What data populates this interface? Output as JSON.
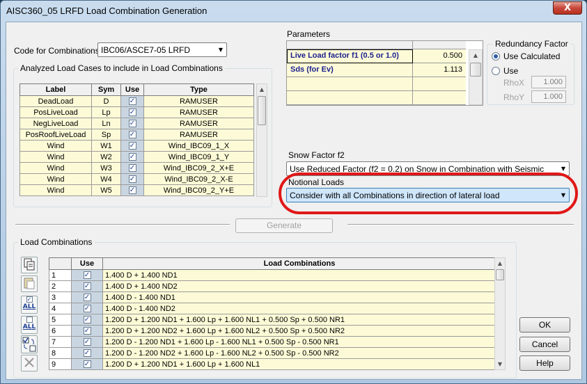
{
  "window": {
    "title": "AISC360_05 LRFD  Load Combination Generation",
    "close_symbol": "X"
  },
  "code": {
    "label": "Code for Combinations:",
    "value": "IBC06/ASCE7-05 LRFD"
  },
  "analyzed": {
    "title": "Analyzed Load Cases to include in Load Combinations",
    "columns": [
      "Label",
      "Sym",
      "Use",
      "Type"
    ],
    "rows": [
      {
        "label": "DeadLoad",
        "sym": "D",
        "use": true,
        "type": "RAMUSER"
      },
      {
        "label": "PosLiveLoad",
        "sym": "Lp",
        "use": true,
        "type": "RAMUSER"
      },
      {
        "label": "NegLiveLoad",
        "sym": "Ln",
        "use": true,
        "type": "RAMUSER"
      },
      {
        "label": "PosRoofLiveLoad",
        "sym": "Sp",
        "use": true,
        "type": "RAMUSER"
      },
      {
        "label": "Wind",
        "sym": "W1",
        "use": true,
        "type": "Wind_IBC09_1_X"
      },
      {
        "label": "Wind",
        "sym": "W2",
        "use": true,
        "type": "Wind_IBC09_1_Y"
      },
      {
        "label": "Wind",
        "sym": "W3",
        "use": true,
        "type": "Wind_IBC09_2_X+E"
      },
      {
        "label": "Wind",
        "sym": "W4",
        "use": true,
        "type": "Wind_IBC09_2_X-E"
      },
      {
        "label": "Wind",
        "sym": "W5",
        "use": true,
        "type": "Wind_IBC09_2_Y+E"
      }
    ]
  },
  "parameters": {
    "title": "Parameters",
    "rows": [
      {
        "name": "Live Load factor f1 (0.5 or 1.0)",
        "value": "0.500"
      },
      {
        "name": "Sds (for Ev)",
        "value": "1.113"
      }
    ]
  },
  "redundancy": {
    "title": "Redundancy Factor",
    "opt_calculated": "Use Calculated",
    "opt_use": "Use",
    "rhox_label": "RhoX",
    "rhox_value": "1.000",
    "rhoy_label": "RhoY",
    "rhoy_value": "1.000",
    "selected": "Use Calculated"
  },
  "snow": {
    "label": "Snow Factor f2",
    "value": "Use Reduced Factor (f2 = 0.2) on Snow in Combination with Seismic"
  },
  "notional": {
    "label": "Notional Loads",
    "value": "Consider with all Combinations in direction of lateral load"
  },
  "generate_label": "Generate",
  "combinations": {
    "title": "Load Combinations",
    "columns": [
      "Use",
      "Load Combinations"
    ],
    "rows": [
      {
        "num": "1",
        "use": true,
        "combo": "1.400 D + 1.400 ND1"
      },
      {
        "num": "2",
        "use": true,
        "combo": "1.400 D + 1.400 ND2"
      },
      {
        "num": "3",
        "use": true,
        "combo": "1.400 D - 1.400 ND1"
      },
      {
        "num": "4",
        "use": true,
        "combo": "1.400 D - 1.400 ND2"
      },
      {
        "num": "5",
        "use": true,
        "combo": "1.200 D + 1.200 ND1 + 1.600 Lp + 1.600 NL1 + 0.500 Sp + 0.500 NR1"
      },
      {
        "num": "6",
        "use": true,
        "combo": "1.200 D + 1.200 ND2 + 1.600 Lp + 1.600 NL2 + 0.500 Sp + 0.500 NR2"
      },
      {
        "num": "7",
        "use": true,
        "combo": "1.200 D - 1.200 ND1 + 1.600 Lp - 1.600 NL1 + 0.500 Sp - 0.500 NR1"
      },
      {
        "num": "8",
        "use": true,
        "combo": "1.200 D - 1.200 ND2 + 1.600 Lp - 1.600 NL2 + 0.500 Sp - 0.500 NR2"
      },
      {
        "num": "9",
        "use": true,
        "combo": "1.200 D + 1.200 ND1 + 1.600 Lp + 1.600 NL1"
      }
    ]
  },
  "toolbar": {
    "all_label": "ALL"
  },
  "buttons": {
    "ok": "OK",
    "cancel": "Cancel",
    "help": "Help"
  },
  "colors": {
    "highlight_oval": "#e01818",
    "grid_cell": "#fdfbd7",
    "param_text": "#1b1f8e"
  }
}
